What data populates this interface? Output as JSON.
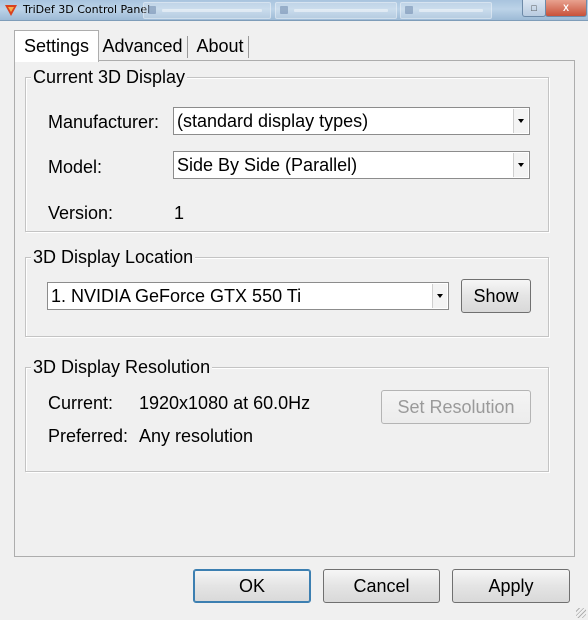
{
  "window": {
    "title": "TriDef 3D Control Panel",
    "close_glyph": "X",
    "restore_glyph": "□"
  },
  "tabs": [
    {
      "label": "Settings",
      "active": true
    },
    {
      "label": "Advanced",
      "active": false
    },
    {
      "label": "About",
      "active": false
    }
  ],
  "current_display": {
    "title": "Current 3D Display",
    "manufacturer_label": "Manufacturer:",
    "manufacturer_value": "(standard display types)",
    "model_label": "Model:",
    "model_value": "Side By Side (Parallel)",
    "version_label": "Version:",
    "version_value": "1"
  },
  "display_location": {
    "title": "3D Display Location",
    "adapter_value": "1. NVIDIA GeForce GTX 550 Ti",
    "show_button": "Show"
  },
  "display_resolution": {
    "title": "3D Display Resolution",
    "current_label": "Current:",
    "current_value": "1920x1080 at 60.0Hz",
    "preferred_label": "Preferred:",
    "preferred_value": "Any resolution",
    "set_button": "Set Resolution"
  },
  "buttons": {
    "ok": "OK",
    "cancel": "Cancel",
    "apply": "Apply"
  },
  "colors": {
    "dialog_bg": "#f0f0f0",
    "disabled_text": "#9a9a9a",
    "titlebar": "#a9c4de"
  }
}
